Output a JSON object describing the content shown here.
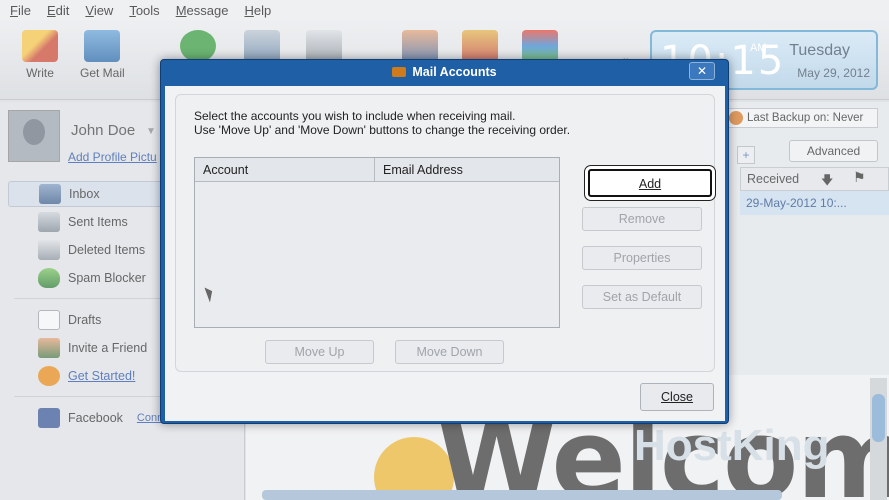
{
  "menubar": {
    "items": [
      "File",
      "Edit",
      "View",
      "Tools",
      "Message",
      "Help"
    ]
  },
  "toolbar": {
    "write_label": "Write",
    "getmail_label": "Get Mail",
    "more_glyph": "»"
  },
  "clock": {
    "time": "10:15",
    "ampm": "AM",
    "day": "Tuesday",
    "date": "May 29, 2012"
  },
  "profile": {
    "name": "John Doe",
    "add_picture_link": "Add Profile Pictu"
  },
  "sidebar": {
    "items": [
      {
        "label": "Inbox",
        "icon": "inbox-icon"
      },
      {
        "label": "Sent Items",
        "icon": "sent-icon"
      },
      {
        "label": "Deleted Items",
        "icon": "trash-icon"
      },
      {
        "label": "Spam Blocker",
        "icon": "shield-icon"
      },
      {
        "label": "Drafts",
        "icon": "draft-icon"
      },
      {
        "label": "Invite a Friend",
        "icon": "people-icon"
      },
      {
        "label": "Get Started!",
        "icon": "info-icon"
      },
      {
        "label": "Facebook",
        "icon": "facebook-icon"
      }
    ],
    "facebook_link": "Conn"
  },
  "right_pane": {
    "backup_label": "Last Backup on:  Never",
    "advanced_label": "Advanced",
    "received_header": "Received",
    "received_value": "29-May-2012 10:...",
    "welcome_text": "Welcome!",
    "brand_text": "HostKing"
  },
  "dialog": {
    "title": "Mail Accounts",
    "close_glyph": "✕",
    "instruction_line1": "Select the accounts you wish to include when receiving mail.",
    "instruction_line2": "Use 'Move Up' and 'Move Down' buttons to change the receiving order.",
    "columns": [
      "Account",
      "Email Address"
    ],
    "buttons": {
      "add": "Add",
      "remove": "Remove",
      "properties": "Properties",
      "set_default": "Set as Default",
      "move_up": "Move Up",
      "move_down": "Move Down",
      "close": "Close"
    }
  },
  "colors": {
    "dialog_frame": "#1f5fa6",
    "link": "#2a55a8"
  }
}
